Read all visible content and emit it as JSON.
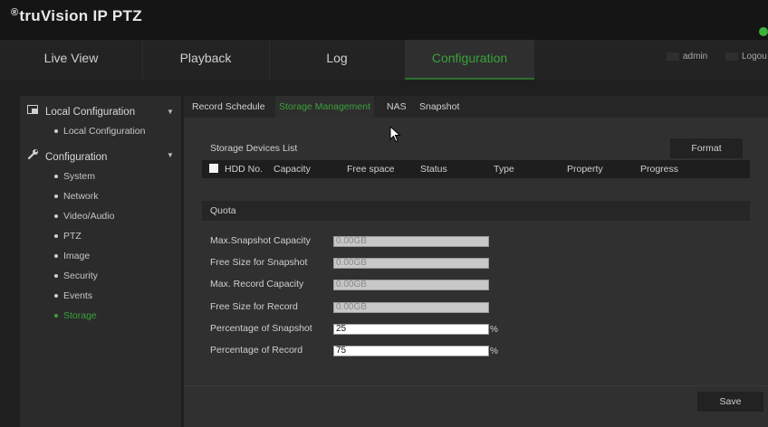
{
  "app": {
    "logo_symbol": "®",
    "logo_text": "truVision  IP PTZ"
  },
  "nav": {
    "tabs": [
      "Live View",
      "Playback",
      "Log",
      "Configuration"
    ],
    "active": "Configuration"
  },
  "user": {
    "name": "admin",
    "logout": "Logou"
  },
  "sidebar": {
    "local_configuration": {
      "label": "Local Configuration",
      "items": [
        "Local Configuration"
      ]
    },
    "configuration": {
      "label": "Configuration",
      "items": [
        "System",
        "Network",
        "Video/Audio",
        "PTZ",
        "Image",
        "Security",
        "Events",
        "Storage"
      ],
      "active": "Storage"
    }
  },
  "subtabs": {
    "items": [
      "Record Schedule",
      "Storage Management",
      "NAS",
      "Snapshot"
    ],
    "active": "Storage Management"
  },
  "storage": {
    "list_title": "Storage Devices List",
    "format_button": "Format",
    "columns": [
      "HDD No.",
      "Capacity",
      "Free space",
      "Status",
      "Type",
      "Property",
      "Progress"
    ]
  },
  "quota": {
    "title": "Quota",
    "fields": [
      {
        "label": "Max.Snapshot Capacity",
        "value": "0.00GB"
      },
      {
        "label": "Free Size for Snapshot",
        "value": "0.00GB"
      },
      {
        "label": "Max. Record Capacity",
        "value": "0.00GB"
      },
      {
        "label": "Free Size for Record",
        "value": "0.00GB"
      },
      {
        "label": "Percentage of Snapshot",
        "value": "25",
        "unit": "%"
      },
      {
        "label": "Percentage of Record",
        "value": "75",
        "unit": "%"
      }
    ]
  },
  "footer": {
    "save_button": "Save"
  },
  "colors": {
    "accent": "#3aa03a",
    "background": "#1f1f1f",
    "panel": "#303030"
  },
  "icons": {
    "help": "help-icon",
    "local_config": "local-config-icon",
    "configuration": "wrench-icon",
    "cursor": "cursor-icon"
  }
}
